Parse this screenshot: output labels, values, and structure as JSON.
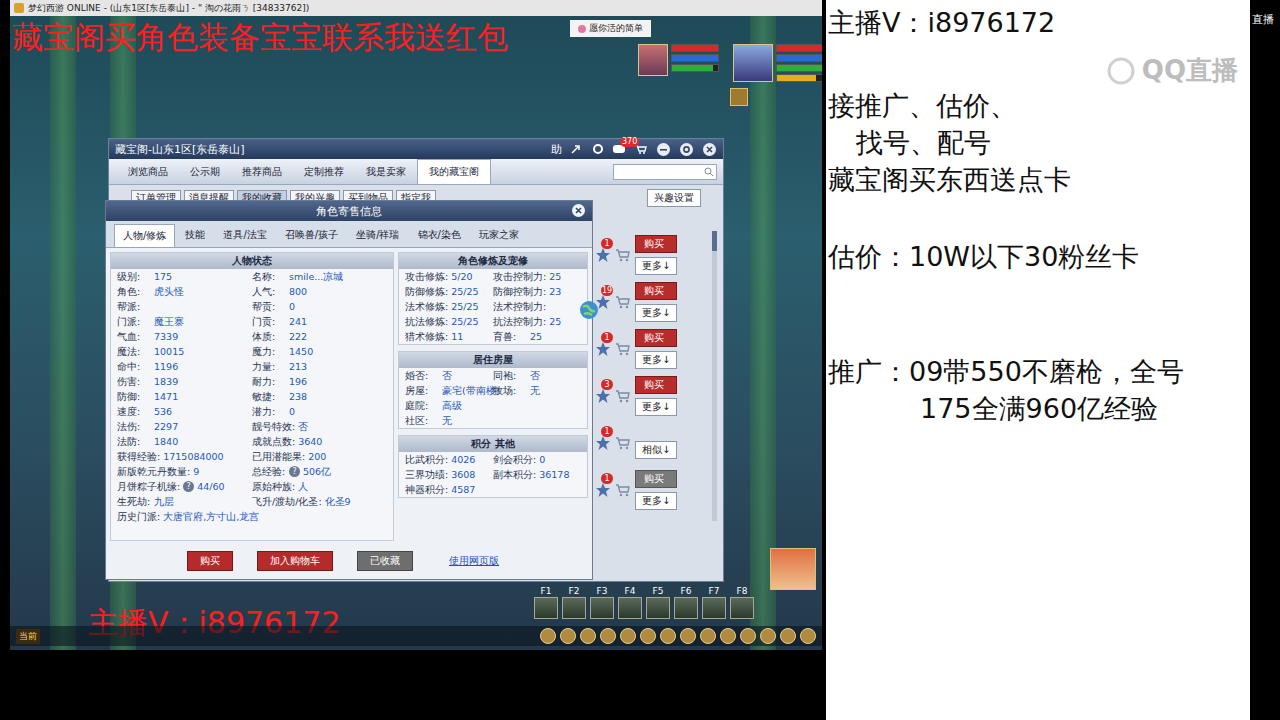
{
  "stream_panel": {
    "watermark": "QQ直播",
    "edge_label": "直播",
    "groups": [
      [
        "主播V：i8976172"
      ],
      [
        "接推广、估价、",
        "找号、配号",
        "藏宝阁买东西送点卡"
      ],
      [
        "估价：10W以下30粉丝卡"
      ],
      [
        "推广：09带550不磨枪，全号",
        "175全满960亿经验"
      ]
    ]
  },
  "game": {
    "title": "梦幻西游 ONLINE - (山东1区[东岳泰山] - \" 淘の花雨ㄋ [34833762])",
    "tab": "愿你活的简单",
    "promo": "藏宝阁买角色装备宝宝联系我送红包",
    "contact": "主播V：i8976172",
    "chat_channel": "当前",
    "hotkeys": [
      "F1",
      "F2",
      "F3",
      "F4",
      "F5",
      "F6",
      "F7",
      "F8"
    ],
    "party": [
      {
        "bars": [
          {
            "color": "#d62a2a",
            "level": 1
          },
          {
            "color": "#2a6ad6",
            "level": 1
          },
          {
            "color": "#2fae3c",
            "level": 0.9
          }
        ]
      },
      {
        "bars": [
          {
            "color": "#d62a2a",
            "level": 1
          },
          {
            "color": "#2a6ad6",
            "level": 1
          },
          {
            "color": "#2fae3c",
            "level": 1
          },
          {
            "color": "#e0b020",
            "level": 0.85
          }
        ]
      }
    ]
  },
  "market": {
    "title": "藏宝阁-山东1区[东岳泰山]",
    "help": "助",
    "message_count": "370",
    "tabs": [
      {
        "label": "浏览商品",
        "selected": false
      },
      {
        "label": "公示期",
        "selected": false
      },
      {
        "label": "推荐商品",
        "selected": false
      },
      {
        "label": "定制推荐",
        "selected": false
      },
      {
        "label": "我是卖家",
        "selected": false
      },
      {
        "label": "我的藏宝阁",
        "selected": true
      }
    ],
    "subtabs": [
      {
        "label": "订单管理",
        "selected": false
      },
      {
        "label": "消息提醒",
        "selected": false
      },
      {
        "label": "我的收藏",
        "selected": true
      },
      {
        "label": "我的兴趣",
        "selected": false
      },
      {
        "label": "买到物品",
        "selected": false
      },
      {
        "label": "指定我",
        "selected": false
      }
    ],
    "interest_button": "兴趣设置",
    "items": [
      {
        "kind": "buy",
        "badge": "1",
        "action": "购买",
        "disabled": false,
        "more": "更多↓"
      },
      {
        "kind": "buy",
        "badge": "19",
        "action": "购买",
        "disabled": false,
        "more": "更多↓"
      },
      {
        "kind": "buy",
        "badge": "1",
        "action": "购买",
        "disabled": false,
        "more": "更多↓"
      },
      {
        "kind": "buy",
        "badge": "3",
        "action": "购买",
        "disabled": false,
        "more": "更多↓"
      },
      {
        "kind": "similar",
        "badge": "1",
        "action": "",
        "disabled": false,
        "more": "相似↓"
      },
      {
        "kind": "buy",
        "badge": "1",
        "action": "购买",
        "disabled": true,
        "more": "更多↓"
      }
    ]
  },
  "dialog": {
    "title": "角色寄售信息",
    "tabs": [
      {
        "label": "人物/修炼",
        "selected": true
      },
      {
        "label": "技能",
        "selected": false
      },
      {
        "label": "道具/法宝",
        "selected": false
      },
      {
        "label": "召唤兽/孩子",
        "selected": false
      },
      {
        "label": "坐骑/祥瑞",
        "selected": false
      },
      {
        "label": "锦衣/染色",
        "selected": false
      },
      {
        "label": "玩家之家",
        "selected": false
      }
    ],
    "status": {
      "title": "人物状态",
      "rows": [
        [
          {
            "label": "级别:",
            "value": "175",
            "help": ""
          },
          {
            "label": "名称:",
            "value": "smile...凉城",
            "help": ""
          }
        ],
        [
          {
            "label": "角色:",
            "value": "虎头怪",
            "help": ""
          },
          {
            "label": "人气:",
            "value": "800",
            "help": ""
          }
        ],
        [
          {
            "label": "帮派:",
            "value": "",
            "help": ""
          },
          {
            "label": "帮贡:",
            "value": "0",
            "help": ""
          }
        ],
        [
          {
            "label": "门派:",
            "value": "魔王寨",
            "help": ""
          },
          {
            "label": "门贡:",
            "value": "241",
            "help": ""
          }
        ],
        [
          {
            "label": "气血:",
            "value": "7339",
            "help": ""
          },
          {
            "label": "体质:",
            "value": "222",
            "help": ""
          }
        ],
        [
          {
            "label": "魔法:",
            "value": "10015",
            "help": ""
          },
          {
            "label": "魔力:",
            "value": "1450",
            "help": ""
          }
        ],
        [
          {
            "label": "命中:",
            "value": "1196",
            "help": ""
          },
          {
            "label": "力量:",
            "value": "213",
            "help": ""
          }
        ],
        [
          {
            "label": "伤害:",
            "value": "1839",
            "help": ""
          },
          {
            "label": "耐力:",
            "value": "196",
            "help": ""
          }
        ],
        [
          {
            "label": "防御:",
            "value": "1471",
            "help": ""
          },
          {
            "label": "敏捷:",
            "value": "238",
            "help": ""
          }
        ],
        [
          {
            "label": "速度:",
            "value": "536",
            "help": ""
          },
          {
            "label": "潜力:",
            "value": "0",
            "help": ""
          }
        ],
        [
          {
            "label": "法伤:",
            "value": "2297",
            "help": ""
          },
          {
            "label": "靓号特效:",
            "value": "否",
            "help": ""
          }
        ],
        [
          {
            "label": "法防:",
            "value": "1840",
            "help": ""
          },
          {
            "label": "成就点数:",
            "value": "3640",
            "help": ""
          }
        ],
        [
          {
            "label": "获得经验:",
            "value": "1715084000",
            "help": ""
          },
          {
            "label": "已用潜能果:",
            "value": "200",
            "help": ""
          }
        ],
        [
          {
            "label": "新版乾元丹数量:",
            "value": "9",
            "help": ""
          },
          {
            "label": "总经验:",
            "value": "506亿",
            "help": "?"
          }
        ],
        [
          {
            "label": "月饼粽子机缘:",
            "value": "44/60",
            "help": "?"
          },
          {
            "label": "原始种族:",
            "value": "人",
            "help": ""
          }
        ],
        [
          {
            "label": "生死劫:",
            "value": "九层",
            "help": ""
          },
          {
            "label": "飞升/渡劫/化圣:",
            "value": "化圣9",
            "help": ""
          }
        ],
        [
          {
            "label": "历史门派:",
            "value": "大唐官府,方寸山,龙宫",
            "help": ""
          }
        ]
      ]
    },
    "cultivation": {
      "title": "角色修炼及宠修",
      "rows": [
        [
          {
            "label": "攻击修炼:",
            "value": "5/20",
            "help": ""
          },
          {
            "label": "攻击控制力:",
            "value": "25",
            "help": ""
          }
        ],
        [
          {
            "label": "防御修炼:",
            "value": "25/25",
            "help": ""
          },
          {
            "label": "防御控制力:",
            "value": "23",
            "help": ""
          }
        ],
        [
          {
            "label": "法术修炼:",
            "value": "25/25",
            "help": ""
          },
          {
            "label": "法术控制力:",
            "value": "",
            "help": ""
          }
        ],
        [
          {
            "label": "抗法修炼:",
            "value": "25/25",
            "help": ""
          },
          {
            "label": "抗法控制力:",
            "value": "25",
            "help": ""
          }
        ],
        [
          {
            "label": "猎术修炼:",
            "value": "11",
            "help": ""
          },
          {
            "label": "育兽:",
            "value": "25",
            "help": ""
          }
        ]
      ]
    },
    "house": {
      "title": "居住房屋",
      "rows": [
        [
          {
            "label": "婚否:",
            "value": "否",
            "help": ""
          },
          {
            "label": "同袍:",
            "value": "否",
            "help": ""
          }
        ],
        [
          {
            "label": "房屋:",
            "value": "豪宅(带南楼)",
            "help": ""
          },
          {
            "label": "牧场:",
            "value": "无",
            "help": ""
          }
        ],
        [
          {
            "label": "庭院:",
            "value": "高级",
            "help": ""
          }
        ],
        [
          {
            "label": "社区:",
            "value": "无",
            "help": ""
          }
        ]
      ]
    },
    "points": {
      "title": "积分 其他",
      "rows": [
        [
          {
            "label": "比武积分:",
            "value": "4026",
            "help": ""
          },
          {
            "label": "剑会积分:",
            "value": "0",
            "help": ""
          }
        ],
        [
          {
            "label": "三界功绩:",
            "value": "3608",
            "help": ""
          },
          {
            "label": "副本积分:",
            "value": "36178",
            "help": ""
          }
        ],
        [
          {
            "label": "神器积分:",
            "value": "4587",
            "help": ""
          }
        ]
      ]
    },
    "buttons": [
      {
        "label": "购买",
        "kind": "primary"
      },
      {
        "label": "加入购物车",
        "kind": "primary"
      },
      {
        "label": "已收藏",
        "kind": "disabled"
      },
      {
        "label": "使用网页版",
        "kind": "link"
      }
    ]
  }
}
